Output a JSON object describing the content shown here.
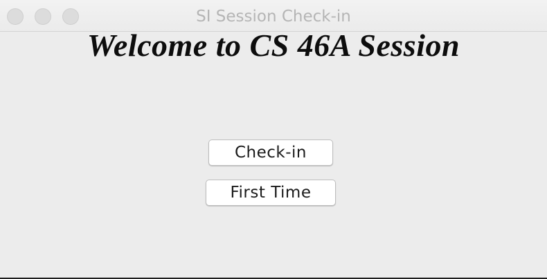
{
  "window": {
    "title": "SI Session Check-in"
  },
  "main": {
    "welcome": "Welcome to CS 46A Session",
    "checkin_label": "Check-in",
    "first_time_label": "First Time"
  }
}
